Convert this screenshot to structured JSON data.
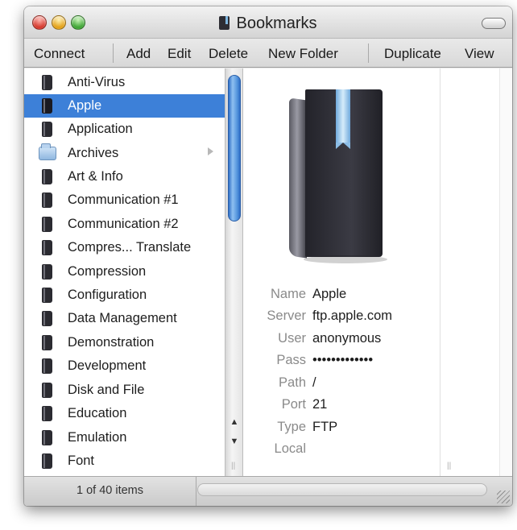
{
  "window": {
    "title": "Bookmarks",
    "controls": [
      "close",
      "minimize",
      "zoom"
    ]
  },
  "toolbar": {
    "connect": "Connect",
    "add": "Add",
    "edit": "Edit",
    "delete": "Delete",
    "new_folder": "New Folder",
    "duplicate": "Duplicate",
    "view": "View"
  },
  "list": {
    "items": [
      {
        "label": "Anti-Virus",
        "icon": "book-icon"
      },
      {
        "label": "Apple",
        "icon": "book-icon",
        "selected": true
      },
      {
        "label": "Application",
        "icon": "book-icon"
      },
      {
        "label": "Archives",
        "icon": "folder-icon",
        "has_children": true
      },
      {
        "label": "Art & Info",
        "icon": "book-icon"
      },
      {
        "label": "Communication #1",
        "icon": "book-icon"
      },
      {
        "label": "Communication #2",
        "icon": "book-icon"
      },
      {
        "label": "Compres... Translate",
        "icon": "book-icon"
      },
      {
        "label": "Compression",
        "icon": "book-icon"
      },
      {
        "label": "Configuration",
        "icon": "book-icon"
      },
      {
        "label": "Data Management",
        "icon": "book-icon"
      },
      {
        "label": "Demonstration",
        "icon": "book-icon"
      },
      {
        "label": "Development",
        "icon": "book-icon"
      },
      {
        "label": "Disk and File",
        "icon": "book-icon"
      },
      {
        "label": "Education",
        "icon": "book-icon"
      },
      {
        "label": "Emulation",
        "icon": "book-icon"
      },
      {
        "label": "Font",
        "icon": "book-icon"
      }
    ]
  },
  "detail": {
    "name_label": "Name",
    "name": "Apple",
    "server_label": "Server",
    "server": "ftp.apple.com",
    "user_label": "User",
    "user": "anonymous",
    "pass_label": "Pass",
    "pass": "•••••••••••••",
    "path_label": "Path",
    "path": "/",
    "port_label": "Port",
    "port": "21",
    "type_label": "Type",
    "type": "FTP",
    "local_label": "Local",
    "local": ""
  },
  "status": {
    "count": "1 of 40 items"
  },
  "colors": {
    "selection": "#3d80d8",
    "scroll_thumb": "#5b9be0"
  }
}
